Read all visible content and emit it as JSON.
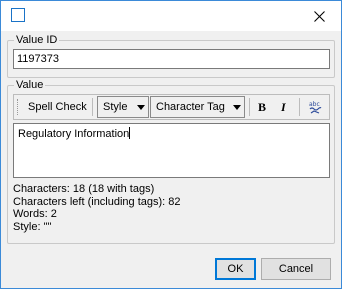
{
  "window": {
    "icon": "window-icon",
    "close_icon": "close-icon"
  },
  "value_id": {
    "label": "Value ID",
    "value": "1197373"
  },
  "value_group": {
    "label": "Value",
    "toolbar": {
      "spell_check": "Spell Check",
      "style_select": "Style",
      "character_tag_select": "Character Tag",
      "bold": "B",
      "italic": "I",
      "spell_icon": "abc-spellcheck-icon"
    },
    "editor_text": "Regulatory Information",
    "stats": {
      "characters": "Characters: 18 (18 with tags)",
      "characters_left": "Characters left (including tags): 82",
      "words": "Words: 2",
      "style": "Style: \"\""
    }
  },
  "buttons": {
    "ok": "OK",
    "cancel": "Cancel"
  },
  "colors": {
    "accent": "#0078d7",
    "window_border": "#3b8ad8"
  }
}
